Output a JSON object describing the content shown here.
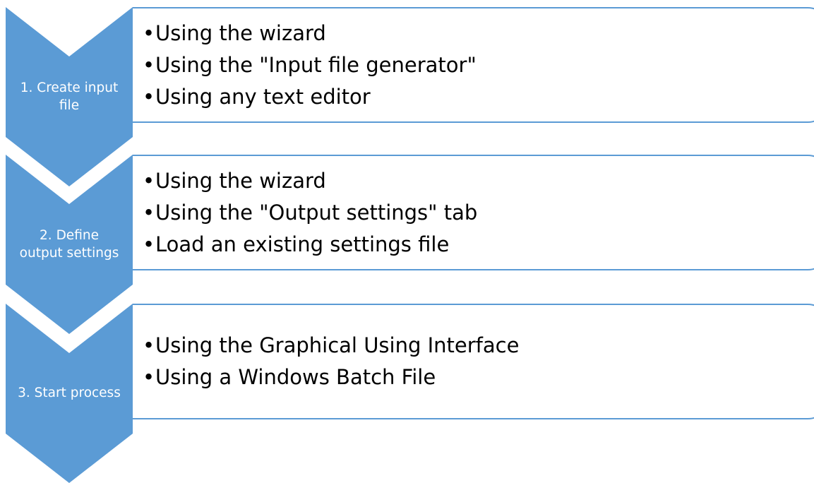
{
  "colors": {
    "chevron_fill": "#5b9bd5",
    "card_border": "#5b9bd5",
    "label_text": "#ffffff",
    "bullet_text": "#000000"
  },
  "bullet_glyph": "•",
  "steps": [
    {
      "label": "1. Create input\nfile",
      "items": [
        "Using the wizard",
        "Using the \"Input file generator\"",
        "Using any text editor"
      ]
    },
    {
      "label": "2. Define\noutput settings",
      "items": [
        "Using the wizard",
        "Using the \"Output settings\" tab",
        "Load an existing settings file"
      ]
    },
    {
      "label": "3. Start process",
      "items": [
        "Using the Graphical Using Interface",
        "Using a Windows Batch File"
      ]
    }
  ]
}
